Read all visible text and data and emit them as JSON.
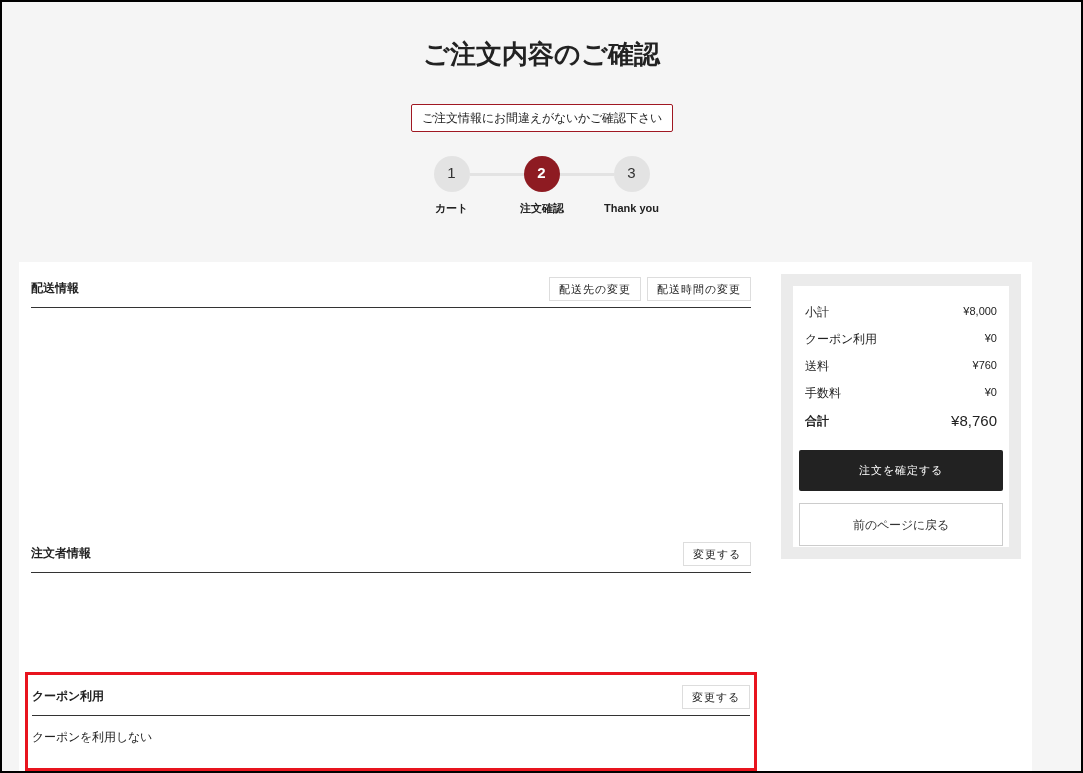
{
  "title": "ご注文内容のご確認",
  "notice": "ご注文情報にお間違えがないかご確認下さい",
  "steps": [
    {
      "number": "1",
      "label": "カート",
      "selected": false
    },
    {
      "number": "2",
      "label": "注文確認",
      "selected": true
    },
    {
      "number": "3",
      "label": "Thank you",
      "selected": false
    }
  ],
  "sections": [
    {
      "title": "配送情報",
      "highlighted": false,
      "buttons": [
        "配送先の変更",
        "配送時間の変更"
      ]
    },
    {
      "title": "注文者情報",
      "highlighted": false,
      "buttons": [
        "変更する"
      ]
    },
    {
      "title": "クーポン利用",
      "highlighted": true,
      "buttons": [
        "変更する"
      ],
      "lines": [
        "クーポンを利用しない"
      ]
    }
  ],
  "summary": {
    "rows": [
      {
        "label": "小計",
        "value": "¥8,000",
        "kind": "line"
      },
      {
        "label": "クーポン利用",
        "value": "¥0",
        "kind": "line"
      },
      {
        "label": "送料",
        "value": "¥760",
        "kind": "line"
      },
      {
        "label": "手数料",
        "value": "¥0",
        "kind": "line"
      },
      {
        "label": "合計",
        "value": "¥8,760",
        "kind": "total"
      }
    ],
    "confirm_button": "注文を確定する",
    "back_button": "前のページに戻る"
  }
}
